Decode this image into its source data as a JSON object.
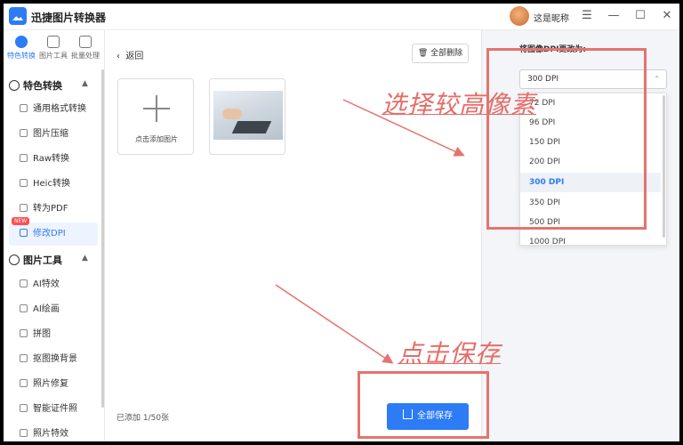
{
  "app": {
    "title": "迅捷图片转换器",
    "username": "这是昵称"
  },
  "window_controls": {
    "menu": "☰",
    "minimize": "—",
    "maximize": "☐",
    "close": "✕"
  },
  "topnav": [
    {
      "label": "特色转换",
      "active": true
    },
    {
      "label": "图片工具",
      "active": false
    },
    {
      "label": "批量处理",
      "active": false
    }
  ],
  "sidebar": {
    "section1": {
      "title": "特色转换",
      "chevron": "▲"
    },
    "section1_items": [
      {
        "label": "通用格式转换"
      },
      {
        "label": "图片压缩"
      },
      {
        "label": "Raw转换"
      },
      {
        "label": "Heic转换"
      },
      {
        "label": "转为PDF"
      },
      {
        "label": "修改DPI",
        "badge": "NEW",
        "active": true
      }
    ],
    "section2": {
      "title": "图片工具",
      "chevron": "▲"
    },
    "section2_items": [
      {
        "label": "AI特效"
      },
      {
        "label": "AI绘画"
      },
      {
        "label": "拼图"
      },
      {
        "label": "抠图换背景"
      },
      {
        "label": "照片修复"
      },
      {
        "label": "智能证件照"
      },
      {
        "label": "照片特效"
      }
    ]
  },
  "main": {
    "back_label": "返回",
    "clear_all_label": "全部删除",
    "add_image_label": "点击添加图片",
    "count_text": "已添加 1/50张",
    "save_all_label": "全部保存"
  },
  "right_panel": {
    "dpi_label": "将图像DPI更改为:",
    "selected_value": "300 DPI",
    "options": [
      "72 DPI",
      "96 DPI",
      "150 DPI",
      "200 DPI",
      "300 DPI",
      "350 DPI",
      "500 DPI",
      "1000 DPI"
    ]
  },
  "annotations": {
    "note_top": "选择较高像素",
    "note_bottom": "点击保存",
    "color": "#e5736e"
  },
  "colors": {
    "accent": "#2d7cf6",
    "badge": "#ff4d4f"
  }
}
